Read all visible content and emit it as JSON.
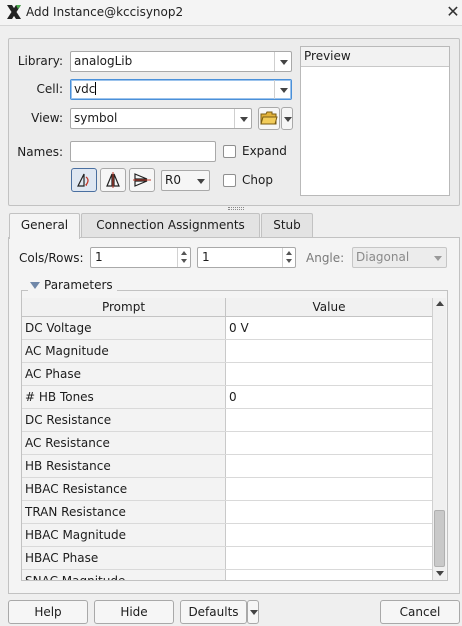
{
  "window": {
    "title": "Add Instance@kccisynop2",
    "close_glyph": "✕"
  },
  "form": {
    "library_label": "Library:",
    "library_value": "analogLib",
    "cell_label": "Cell:",
    "cell_value": "vdc",
    "view_label": "View:",
    "view_value": "symbol",
    "names_label": "Names:",
    "names_value": "",
    "expand_label": "Expand",
    "chop_label": "Chop",
    "rotation_value": "R0"
  },
  "preview": {
    "label": "Preview"
  },
  "tabs": [
    {
      "label": "General"
    },
    {
      "label": "Connection Assignments"
    },
    {
      "label": "Stub"
    }
  ],
  "general": {
    "colsrows_label": "Cols/Rows:",
    "cols_value": "1",
    "rows_value": "1",
    "angle_label": "Angle:",
    "angle_value": "Diagonal",
    "parameters_label": "Parameters"
  },
  "table": {
    "headers": {
      "prompt": "Prompt",
      "value": "Value"
    },
    "rows": [
      {
        "prompt": "DC Voltage",
        "value": "0 V"
      },
      {
        "prompt": "AC Magnitude",
        "value": ""
      },
      {
        "prompt": "AC Phase",
        "value": ""
      },
      {
        "prompt": "# HB Tones",
        "value": "0"
      },
      {
        "prompt": "DC Resistance",
        "value": ""
      },
      {
        "prompt": "AC Resistance",
        "value": ""
      },
      {
        "prompt": "HB Resistance",
        "value": ""
      },
      {
        "prompt": "HBAC Resistance",
        "value": ""
      },
      {
        "prompt": "TRAN Resistance",
        "value": ""
      },
      {
        "prompt": "HBAC Magnitude",
        "value": ""
      },
      {
        "prompt": "HBAC Phase",
        "value": ""
      },
      {
        "prompt": "SNAC Magnitude",
        "value": ""
      }
    ]
  },
  "buttons": {
    "help": "Help",
    "hide": "Hide",
    "defaults": "Defaults",
    "cancel": "Cancel"
  },
  "colors": {
    "accent": "#4a90d9",
    "app_icon": "#222222",
    "param_triangle": "#6f87a8"
  }
}
